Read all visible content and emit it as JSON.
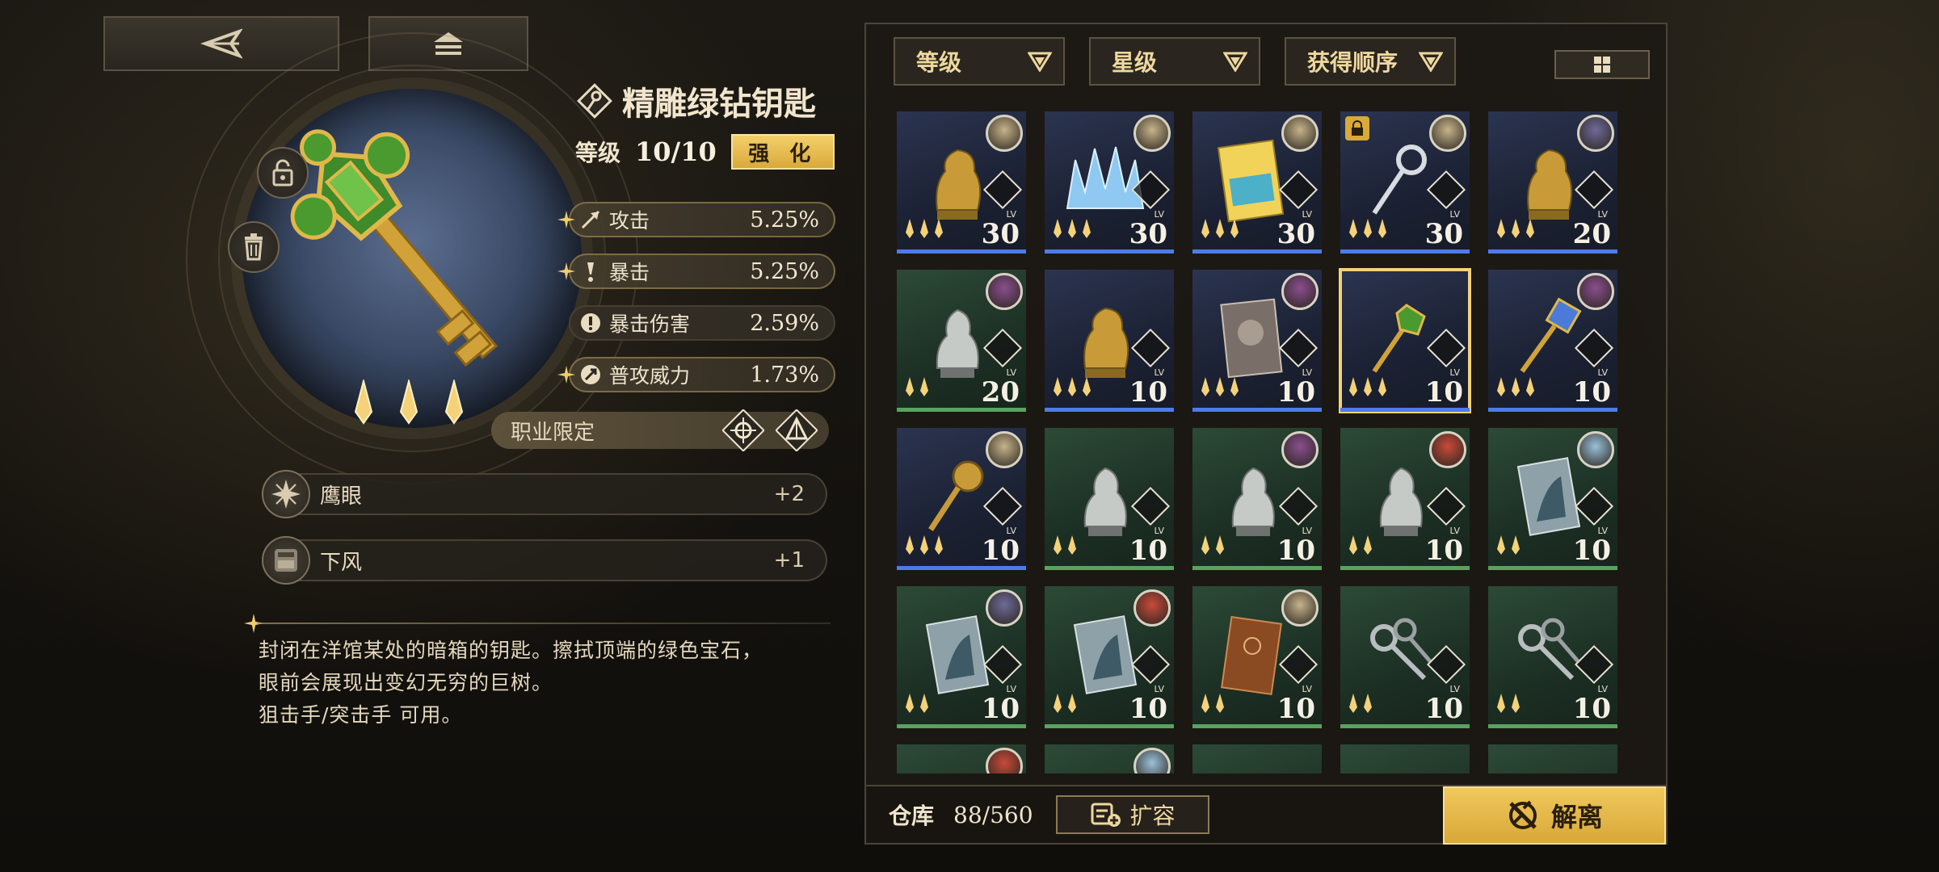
{
  "item": {
    "name": "精雕绿钻钥匙",
    "level_label": "等级",
    "level_value": "10/10",
    "enhance_label": "强 化",
    "stars": 3
  },
  "stats": [
    {
      "name": "攻击",
      "value": "5.25%",
      "icon": "arrow-icon",
      "highlight": true
    },
    {
      "name": "暴击",
      "value": "5.25%",
      "icon": "crit-icon",
      "highlight": true
    },
    {
      "name": "暴击伤害",
      "value": "2.59%",
      "icon": "crit-damage-icon",
      "highlight": false
    },
    {
      "name": "普攻威力",
      "value": "1.73%",
      "icon": "normal-attack-icon",
      "highlight": true
    }
  ],
  "job_restriction": {
    "label": "职业限定"
  },
  "skills": [
    {
      "name": "鹰眼",
      "value": "+2",
      "icon": "hawkeye-icon"
    },
    {
      "name": "下风",
      "value": "+1",
      "icon": "downwind-icon"
    }
  ],
  "description": [
    "封闭在洋馆某处的暗箱的钥匙。擦拭顶端的绿色宝石，",
    "眼前会展现出变幻无穷的巨树。",
    "狙击手/突击手 可用。"
  ],
  "filters": [
    {
      "label": "等级"
    },
    {
      "label": "星级"
    },
    {
      "label": "获得顺序"
    }
  ],
  "inventory": [
    {
      "level": "30",
      "rarity": "blue",
      "stars": 3,
      "art": "gold-bust",
      "avatar": "#c7b38a",
      "lock": false
    },
    {
      "level": "30",
      "rarity": "blue",
      "stars": 3,
      "art": "ice-crown",
      "avatar": "#c7b38a",
      "lock": false
    },
    {
      "level": "30",
      "rarity": "blue",
      "stars": 3,
      "art": "holiday-book",
      "avatar": "#c7b38a",
      "lock": false
    },
    {
      "level": "30",
      "rarity": "blue",
      "stars": 3,
      "art": "silver-key",
      "avatar": "#c7b38a",
      "lock": true
    },
    {
      "level": "20",
      "rarity": "blue",
      "stars": 3,
      "art": "gold-bust",
      "avatar": "#6f6a98",
      "lock": false
    },
    {
      "level": "20",
      "rarity": "green",
      "stars": 2,
      "art": "silver-bust",
      "avatar": "#8a4f8e",
      "lock": false
    },
    {
      "level": "10",
      "rarity": "blue",
      "stars": 3,
      "art": "gold-bust",
      "avatar": "",
      "lock": false
    },
    {
      "level": "10",
      "rarity": "blue",
      "stars": 3,
      "art": "portrait-book",
      "avatar": "#8a4f8e",
      "lock": false
    },
    {
      "level": "10",
      "rarity": "blue",
      "stars": 3,
      "art": "green-key",
      "avatar": "",
      "lock": false,
      "selected": true
    },
    {
      "level": "10",
      "rarity": "blue",
      "stars": 3,
      "art": "gem-key",
      "avatar": "#8a4f8e",
      "lock": false
    },
    {
      "level": "10",
      "rarity": "blue",
      "stars": 3,
      "art": "gold-key",
      "avatar": "#c7b38a",
      "lock": false
    },
    {
      "level": "10",
      "rarity": "green",
      "stars": 2,
      "art": "silver-bust",
      "avatar": "",
      "lock": false
    },
    {
      "level": "10",
      "rarity": "green",
      "stars": 2,
      "art": "silver-bust",
      "avatar": "#8a4f8e",
      "lock": false
    },
    {
      "level": "10",
      "rarity": "green",
      "stars": 2,
      "art": "silver-bust",
      "avatar": "#c94a3a",
      "lock": false
    },
    {
      "level": "10",
      "rarity": "green",
      "stars": 2,
      "art": "card",
      "avatar": "#9ac0d8",
      "lock": false
    },
    {
      "level": "10",
      "rarity": "green",
      "stars": 2,
      "art": "card",
      "avatar": "#6f6a98",
      "lock": false
    },
    {
      "level": "10",
      "rarity": "green",
      "stars": 2,
      "art": "card",
      "avatar": "#c94a3a",
      "lock": false
    },
    {
      "level": "10",
      "rarity": "green",
      "stars": 2,
      "art": "brown-book",
      "avatar": "#c7b38a",
      "lock": false
    },
    {
      "level": "10",
      "rarity": "green",
      "stars": 2,
      "art": "keys",
      "avatar": "",
      "lock": false
    },
    {
      "level": "10",
      "rarity": "green",
      "stars": 2,
      "art": "keys",
      "avatar": "",
      "lock": false
    },
    {
      "level": "",
      "rarity": "green",
      "stars": 0,
      "art": "",
      "avatar": "#c94a3a",
      "lock": false
    },
    {
      "level": "",
      "rarity": "green",
      "stars": 0,
      "art": "",
      "avatar": "#9ac0d8",
      "lock": false
    },
    {
      "level": "",
      "rarity": "green",
      "stars": 0,
      "art": "",
      "avatar": "",
      "lock": false
    },
    {
      "level": "",
      "rarity": "green",
      "stars": 0,
      "art": "",
      "avatar": "",
      "lock": false
    },
    {
      "level": "",
      "rarity": "green",
      "stars": 0,
      "art": "",
      "avatar": "",
      "lock": false
    }
  ],
  "footer": {
    "warehouse_label": "仓库",
    "warehouse_count": "88/560",
    "expand_label": "扩容",
    "dismantle_label": "解离"
  },
  "colors": {
    "gold": "#f0c85c",
    "blue_rarity": "#4d7bea",
    "green_rarity": "#58a35d"
  }
}
